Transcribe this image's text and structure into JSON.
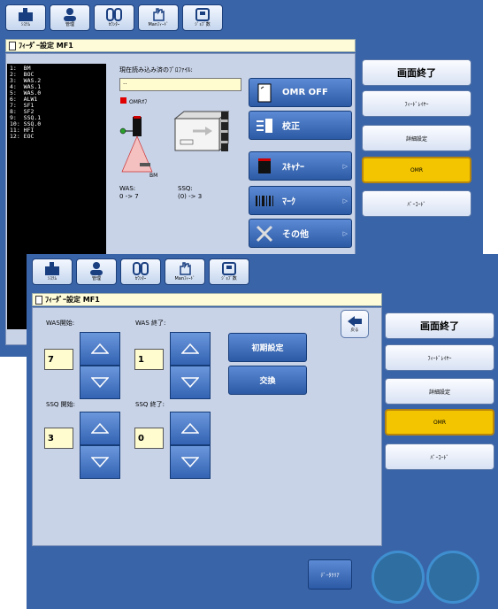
{
  "toolbar": {
    "buttons": [
      {
        "icon": "system-icon",
        "label": "ｼｽﾃﾑ"
      },
      {
        "icon": "admin-icon",
        "label": "管理"
      },
      {
        "icon": "counter-icon",
        "label": "ｶｳﾝﾀｰ"
      },
      {
        "icon": "manual-feed-icon",
        "label": "Manﾌｨｰﾄﾞ"
      },
      {
        "icon": "job-icon",
        "label": "ｼﾞｮﾌﾞ数"
      }
    ]
  },
  "screen1": {
    "title": "ﾌｨｰﾀﾞｰ設定 MF1",
    "list_items": [
      "1:  BM",
      "2:  BOC",
      "3:  WAS.2",
      "4:  WAS.1",
      "5:  WAS.0",
      "6:  ALW1",
      "7:  SF1",
      "8:  SF2",
      "9:  SSQ.1",
      "10: SSQ.0",
      "11: HFI",
      "12: EOC"
    ],
    "profile_label": "現在読み込み済のﾌﾟﾛﾌｧｲﾙ:",
    "profile_value": "..",
    "omr_indicator": "OMRｵﾌ",
    "bm_label": "BM",
    "was_label": "WAS:",
    "was_value": "0 -> 7",
    "ssq_label": "SSQ:",
    "ssq_value": "(0) -> 3",
    "action_buttons": {
      "omr_off": "OMR OFF",
      "calibrate": "校正",
      "scanner": "ｽｷｬﾅｰ",
      "mark": "ﾏｰｸ",
      "other": "その他"
    }
  },
  "screen2": {
    "title": "ﾌｨｰﾀﾞｰ設定 MF1",
    "was_start_label": "WAS開始:",
    "was_start_value": "7",
    "was_end_label": "WAS 終了:",
    "was_end_value": "1",
    "ssq_start_label": "SSQ 開始:",
    "ssq_start_value": "3",
    "ssq_end_label": "SSQ 終了:",
    "ssq_end_value": "0",
    "init_button": "初期設定",
    "swap_button": "交換",
    "back_label": "戻る",
    "data_clear_button": "ﾃﾞｰﾀｸﾘｱ"
  },
  "right_panel": {
    "exit": "画面終了",
    "feeder_layer": "ﾌｨｰﾄﾞﾚｲﾔｰ",
    "detail_settings": "詳細設定",
    "omr": "OMR",
    "barcode": "ﾊﾞｰｺｰﾄﾞ"
  },
  "colors": {
    "background": "#3a64a8",
    "selected": "#f2c500",
    "action": "#3a6cbc"
  }
}
